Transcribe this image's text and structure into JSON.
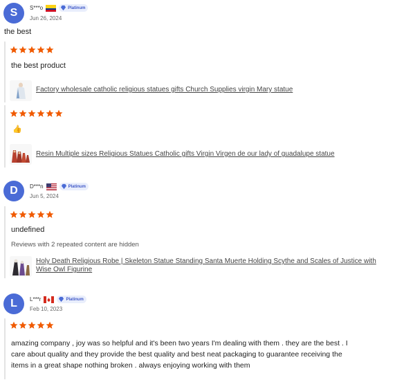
{
  "reviews": [
    {
      "initial": "S",
      "user": "S***o",
      "badge": "Platinum",
      "date": "Jun 26, 2024",
      "text": "the best",
      "sub1": {
        "text": "the best product",
        "product": "Factory wholesale catholic religious statues gifts Church Supplies virgin Mary statue"
      },
      "sub2": {
        "product": "Resin Multiple sizes Religious Statues Catholic gifts Virgin Virgen de our lady of guadalupe statue"
      }
    },
    {
      "initial": "D",
      "user": "D***n",
      "badge": "Platinum",
      "date": "Jun 5, 2024",
      "text": "undefined",
      "hidden_note": "Reviews with 2 repeated content are hidden",
      "product_line1": "Holy Death Religious Robe | Skeleton Statue Standing Santa Muerte Holding Scythe and Scales of Justice with",
      "product_line2": "Wise Owl Figurine"
    },
    {
      "initial": "L",
      "user": "L***r",
      "badge": "Platinum",
      "date": "Feb 10, 2023",
      "text_line1": "amazing company , joy was so helpful and it's been two years I'm dealing with them . they are the best . I",
      "text_line2": "care about quality and they provide the best quality and best neat packaging to guarantee receiving the",
      "text_line3": "items in a great shape nothing broken . always enjoying working with them"
    }
  ],
  "colors": {
    "avatar": "#4a6bd6",
    "star": "#f05a00",
    "badge_text": "#3e57c7"
  }
}
